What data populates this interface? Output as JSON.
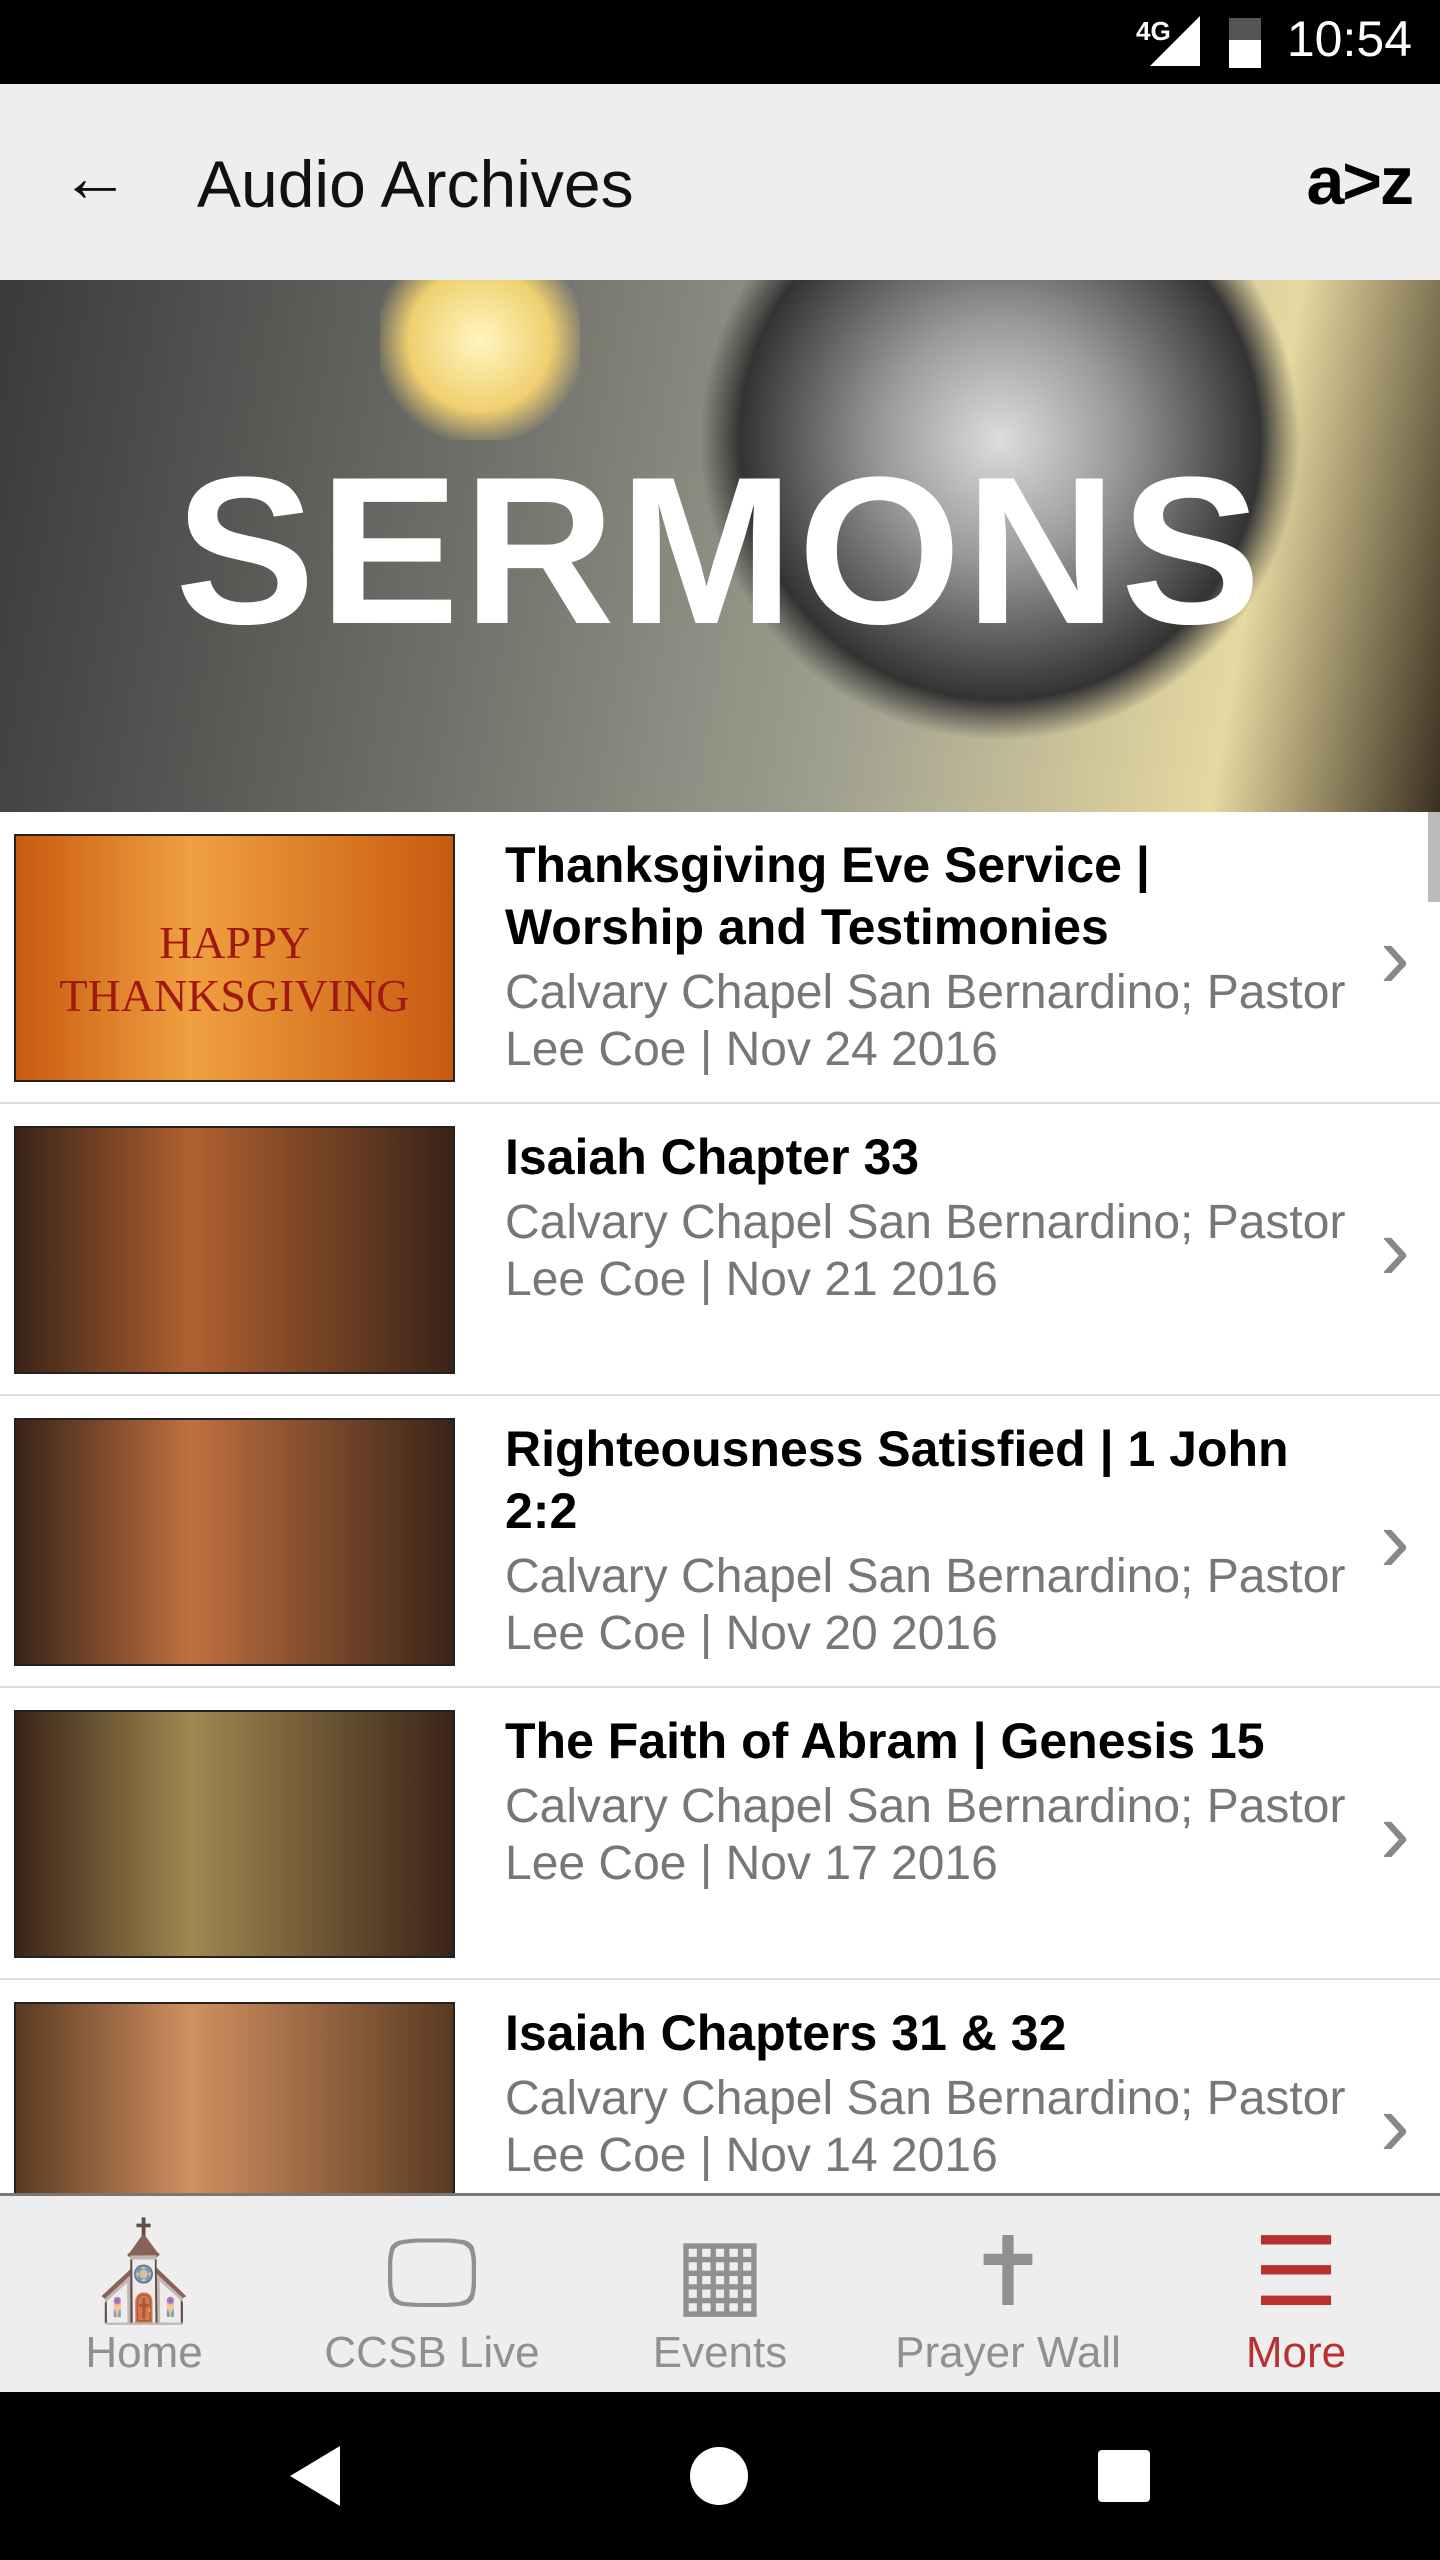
{
  "status_bar": {
    "network": "4G",
    "time": "10:54"
  },
  "app_bar": {
    "title": "Audio Archives",
    "back_icon": "arrow-left-icon",
    "sort_label": "a>z"
  },
  "banner": {
    "text": "SERMONS"
  },
  "sermons": [
    {
      "title": "Thanksgiving Eve Service | Worship and Testimonies",
      "subtitle": "Calvary Chapel San Bernardino; Pastor Lee Coe | Nov 24 2016",
      "thumb": [
        "#c85a10",
        "#f0a040"
      ],
      "thumb_text": "HAPPY THANKSGIVING"
    },
    {
      "title": "Isaiah Chapter 33",
      "subtitle": "Calvary Chapel San Bernardino; Pastor Lee Coe | Nov 21 2016",
      "thumb": [
        "#3a2418",
        "#b06030"
      ]
    },
    {
      "title": "Righteousness Satisfied | 1 John 2:2",
      "subtitle": "Calvary Chapel San Bernardino; Pastor Lee Coe | Nov 20 2016",
      "thumb": [
        "#3a2418",
        "#c07040"
      ]
    },
    {
      "title": "The Faith of Abram | Genesis 15",
      "subtitle": "Calvary Chapel San Bernardino; Pastor Lee Coe | Nov 17 2016",
      "thumb": [
        "#3a2418",
        "#a08850"
      ]
    },
    {
      "title": "Isaiah Chapters 31 & 32",
      "subtitle": "Calvary Chapel San Bernardino; Pastor Lee Coe | Nov 14 2016",
      "thumb": [
        "#5a3a22",
        "#d09060"
      ]
    }
  ],
  "bottom_nav": [
    {
      "label": "Home",
      "icon": "church-icon",
      "glyph": "⛪"
    },
    {
      "label": "CCSB Live",
      "icon": "monitor-icon",
      "glyph": "🖵"
    },
    {
      "label": "Events",
      "icon": "calendar-icon",
      "glyph": "▦"
    },
    {
      "label": "Prayer Wall",
      "icon": "prayer-bubble-icon",
      "glyph": "✝"
    },
    {
      "label": "More",
      "icon": "menu-icon",
      "glyph": "☰",
      "active": true
    }
  ],
  "colors": {
    "accent": "#b83030",
    "inactive": "#909090",
    "appbar": "#eeeeee"
  }
}
